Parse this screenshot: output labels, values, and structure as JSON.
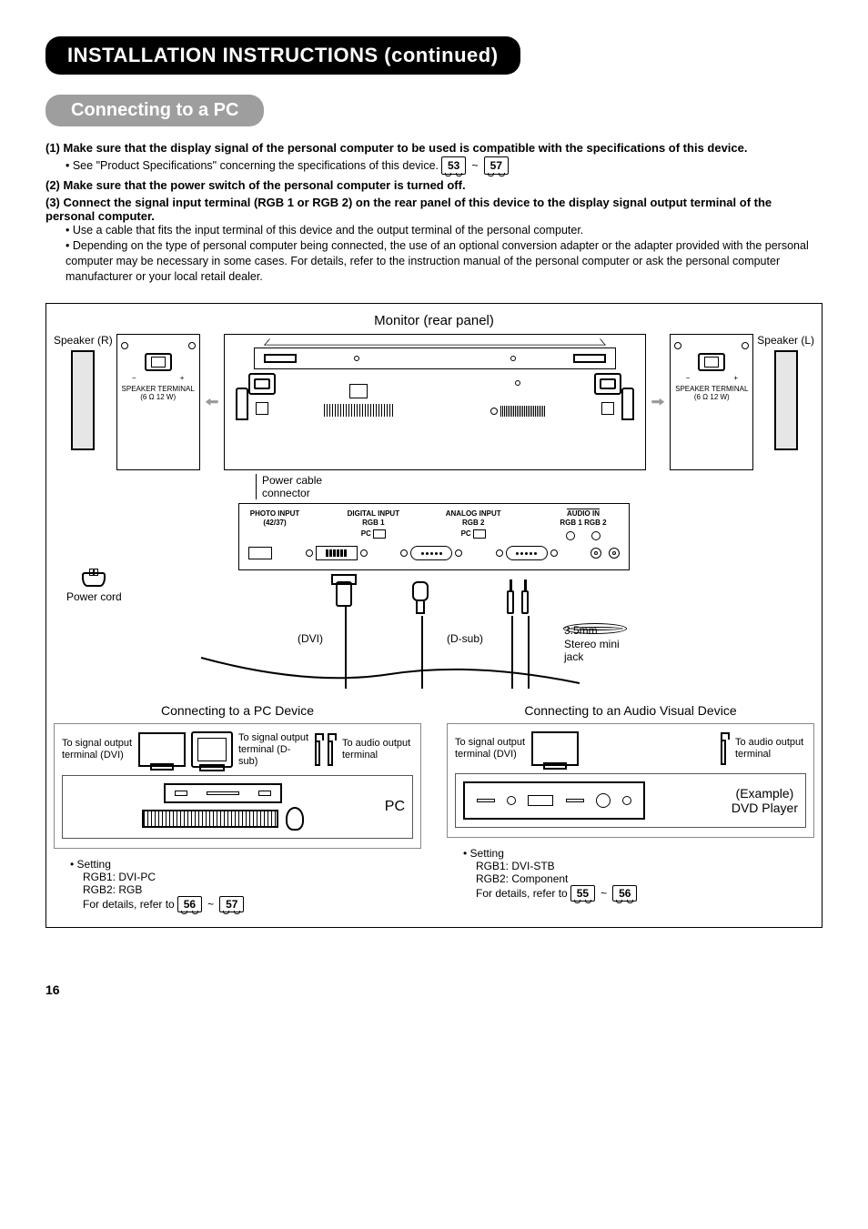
{
  "page_number": "16",
  "headings": {
    "main": "INSTALLATION INSTRUCTIONS (continued)",
    "sub": "Connecting to a PC"
  },
  "instructions": {
    "item1_bold": "(1) Make sure that the display signal of the personal computer to be used is compatible with the specifications of this device.",
    "item1_sub_prefix": "• See \"Product Specifications\" concerning the specifications of this device.",
    "item1_page_a": "53",
    "item1_page_b": "57",
    "item2_bold": "(2) Make sure that the power switch of the personal computer is turned off.",
    "item3_bold": "(3) Connect the signal input terminal (RGB 1 or RGB 2) on the rear panel of this device to the display signal output terminal of the personal computer.",
    "item3_sub1": "• Use a cable that fits the input terminal of this device and the output terminal of the personal computer.",
    "item3_sub2": "• Depending on the type of personal computer being connected, the use of an optional conversion adapter or the adapter provided with the personal computer may be necessary in some cases. For details, refer to the instruction manual of the personal computer or ask the personal computer manufacturer or your local retail dealer."
  },
  "diagram": {
    "title": "Monitor (rear panel)",
    "speaker_r": "Speaker (R)",
    "speaker_l": "Speaker (L)",
    "speaker_terminal_line1": "SPEAKER TERMINAL",
    "speaker_terminal_line2": "(6 Ω 12 W)",
    "port_labels": {
      "photo_line1": "PHOTO INPUT",
      "photo_line2": "(42/37)",
      "digital_line1": "DIGITAL INPUT",
      "digital_line2": "RGB 1",
      "digital_line3": "PC",
      "analog_line1": "ANALOG INPUT",
      "analog_line2": "RGB 2",
      "analog_line3": "PC",
      "audio_line1": "AUDIO IN",
      "audio_line2": "RGB 1  RGB 2"
    },
    "annot": {
      "power_cable_connector": "Power cable connector",
      "power_cord": "Power cord",
      "dvi": "(DVI)",
      "dsub": "(D-sub)",
      "stereo_jack": "3.5mm Stereo mini jack"
    }
  },
  "lower_left": {
    "title": "Connecting to a PC Device",
    "cap_dvi": "To signal output terminal (DVI)",
    "cap_dsub": "To signal output terminal (D-sub)",
    "cap_audio": "To audio output terminal",
    "pc_label": "PC",
    "setting_header": "• Setting",
    "setting_l1": "RGB1: DVI-PC",
    "setting_l2": "RGB2: RGB",
    "setting_ref": "For details, refer to",
    "page_a": "56",
    "page_b": "57"
  },
  "lower_right": {
    "title": "Connecting to an Audio Visual Device",
    "cap_dvi": "To signal output terminal (DVI)",
    "cap_audio": "To audio output terminal",
    "dvd_label_l1": "(Example)",
    "dvd_label_l2": "DVD Player",
    "setting_header": "• Setting",
    "setting_l1": "RGB1: DVI-STB",
    "setting_l2": "RGB2: Component",
    "setting_ref": "For details, refer to",
    "page_a": "55",
    "page_b": "56"
  },
  "tilde": "~",
  "minus": "−",
  "plus": "+"
}
